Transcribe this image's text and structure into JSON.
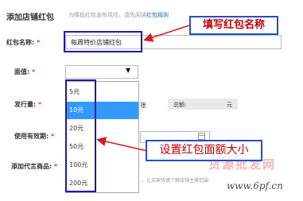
{
  "header": {
    "title": "添加店铺红包",
    "hint_text": "为降低红包发布风险，请先阅读",
    "hint_link": "红包规则"
  },
  "form": {
    "name": {
      "label": "红包名称:",
      "required_mark": "*",
      "value": "每周特价店铺红包"
    },
    "denomination": {
      "label": "面值:",
      "required_mark": "*",
      "options": [
        "5元",
        "10元",
        "20元",
        "50元",
        "100元",
        "200元"
      ],
      "highlighted_option": "10元"
    },
    "quantity": {
      "label": "发行量:",
      "required_mark": "*",
      "unit": "张",
      "total_label": "总额:",
      "total_unit": "元"
    },
    "validity": {
      "label": "使用有效期:",
      "required_mark": "*",
      "separator": "-"
    },
    "code": {
      "label": "添加代言商品:",
      "required_mark": "*",
      "hint": "，让买家快速了解店铺主营范围"
    }
  },
  "annotations": {
    "fill_name": "填写红包名称",
    "set_denomination": "设置红包面额大小",
    "colors": {
      "callout_text": "#c00000",
      "callout_border": "#2050c8",
      "highlight_box": "#1a1aaa",
      "arrow": "#d02020",
      "selected_option": "#3399ff"
    }
  },
  "watermark": {
    "text": "货源批发网",
    "url": "www.6pf.cn"
  }
}
